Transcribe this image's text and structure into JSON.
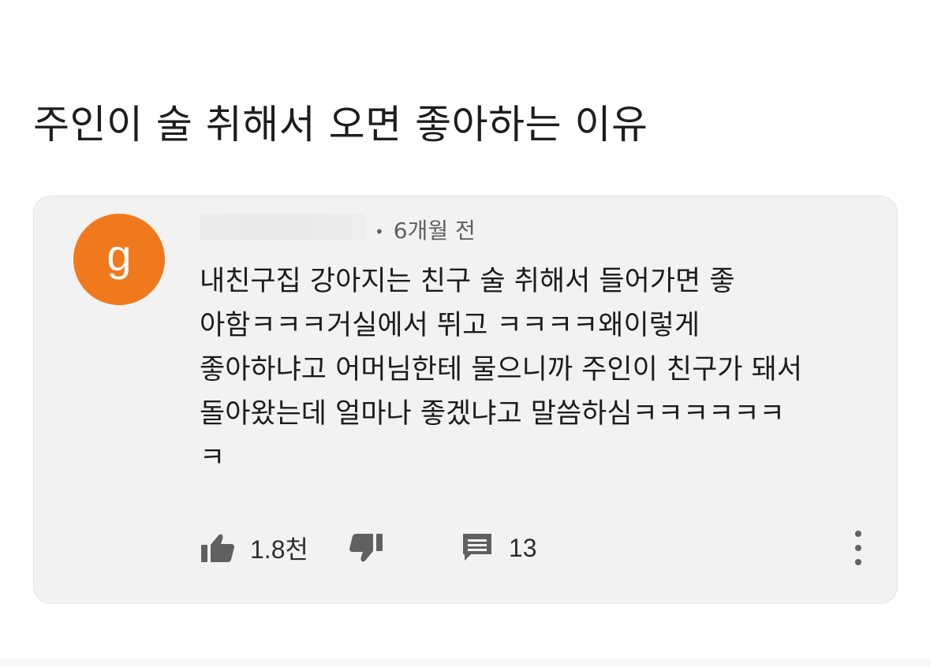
{
  "post": {
    "title": "주인이 술 취해서 오면 좋아하는 이유"
  },
  "comment": {
    "avatar_letter": "g",
    "avatar_color": "#f1791d",
    "time_ago": "6개월 전",
    "lines": [
      "내친구집 강아지는 친구 술 취해서 들어가면 좋",
      "아함ㅋㅋㅋ거실에서 뛰고 ㅋㅋㅋㅋ왜이렇게",
      "좋아하냐고 어머님한테 물으니까 주인이 친구가 돼서",
      "돌아왔는데 얼마나 좋겠냐고 말씀하심ㅋㅋㅋㅋㅋㅋ",
      "ㅋ"
    ],
    "likes": "1.8천",
    "replies": "13"
  },
  "icons": {
    "like": "thumbs-up-icon",
    "dislike": "thumbs-down-icon",
    "reply": "comment-icon",
    "more": "more-vertical-icon"
  }
}
